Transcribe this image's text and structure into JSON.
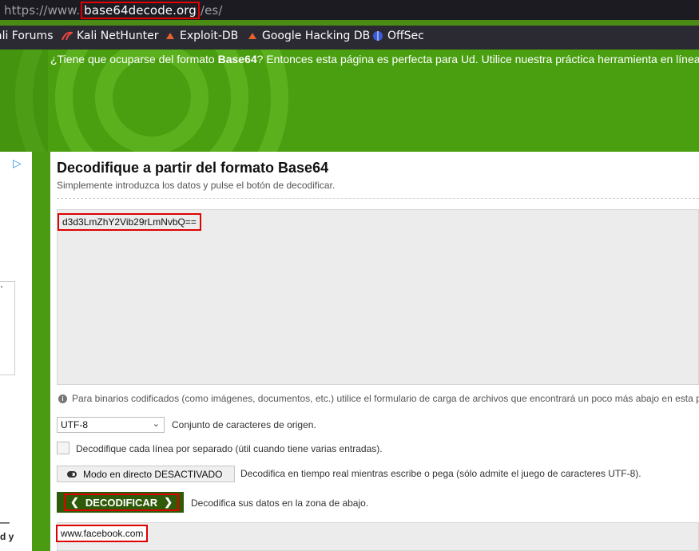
{
  "browser": {
    "url_prefix": "https://www.",
    "url_host": "base64decode.org",
    "url_suffix": "/es/",
    "bookmarks": [
      {
        "label": "ali Forums",
        "icon": "kali-icon"
      },
      {
        "label": "Kali NetHunter",
        "icon": "kali-icon"
      },
      {
        "label": "Exploit-DB",
        "icon": "exploit-db-icon"
      },
      {
        "label": "Google Hacking DB",
        "icon": "exploit-db-icon"
      },
      {
        "label": "OffSec",
        "icon": "offsec-icon"
      }
    ]
  },
  "hero": {
    "text_before": "¿Tiene que ocuparse del formato ",
    "text_bold": "Base64",
    "text_after": "? Entonces esta página es perfecta para Ud. Utilice nuestra práctica herramienta en línea"
  },
  "ad": {
    "text": "—\nd y"
  },
  "main": {
    "title": "Decodifique a partir del formato Base64",
    "subtitle": "Simplemente introduzca los datos y pulse el botón de decodificar.",
    "input_value": "d3d3LmZhY2Vib29rLmNvbQ==",
    "info": "Para binarios codificados (como imágenes, documentos, etc.) utilice el formulario de carga de archivos que encontrará un poco más abajo en esta p",
    "charset_value": "UTF-8",
    "charset_label": "Conjunto de caracteres de origen.",
    "per_line_label": "Decodifique cada línea por separado (útil cuando tiene varias entradas).",
    "live_button": "Modo en directo DESACTIVADO",
    "live_desc": "Decodifica en tiempo real mientras escribe o pega (sólo admite el juego de caracteres UTF-8).",
    "decode_button": "DECODIFICAR",
    "decode_desc": "Decodifica sus datos en la zona de abajo.",
    "output_value": "www.facebook.com"
  },
  "colors": {
    "accent_green": "#4a9f10",
    "button_green": "#2f5a07",
    "highlight_red": "#e00000"
  }
}
